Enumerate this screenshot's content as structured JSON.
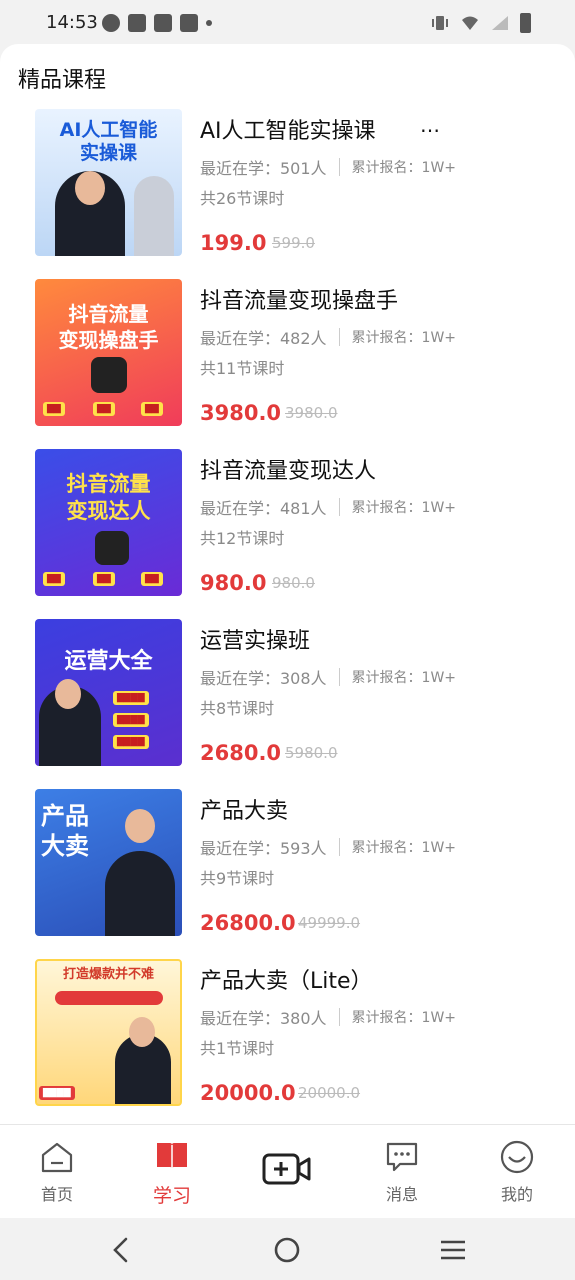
{
  "status": {
    "time": "14:53"
  },
  "section_title": "精品课程",
  "courses": [
    {
      "title": "AI人工智能实操课",
      "ellipsis": "…",
      "recent": "最近在学：501人",
      "enrolled": "累计报名：1W+",
      "lessons": "共26节课时",
      "price": "199.0",
      "original_price": "599.0",
      "cover_text": "AI人工智能\n实操课"
    },
    {
      "title": "抖音流量变现操盘手",
      "recent": "最近在学：482人",
      "enrolled": "累计报名：1W+",
      "lessons": "共11节课时",
      "price": "3980.0",
      "original_price": "3980.0",
      "cover_text": "抖音流量\n变现操盘手"
    },
    {
      "title": "抖音流量变现达人",
      "recent": "最近在学：481人",
      "enrolled": "累计报名：1W+",
      "lessons": "共12节课时",
      "price": "980.0",
      "original_price": "980.0",
      "cover_text": "抖音流量\n变现达人"
    },
    {
      "title": "运营实操班",
      "recent": "最近在学：308人",
      "enrolled": "累计报名：1W+",
      "lessons": "共8节课时",
      "price": "2680.0",
      "original_price": "5980.0",
      "cover_text": "运营大全"
    },
    {
      "title": "产品大卖",
      "recent": "最近在学：593人",
      "enrolled": "累计报名：1W+",
      "lessons": "共9节课时",
      "price": "26800.0",
      "original_price": "49999.0",
      "cover_text": "产品\n大卖"
    },
    {
      "title": "产品大卖（Lite）",
      "recent": "最近在学：380人",
      "enrolled": "累计报名：1W+",
      "lessons": "共1节课时",
      "price": "20000.0",
      "original_price": "20000.0",
      "cover_text": "打造爆款并不难"
    }
  ],
  "tabbar": {
    "home": "首页",
    "learn": "学习",
    "messages": "消息",
    "mine": "我的"
  },
  "colors": {
    "accent": "#e23a3a",
    "muted": "#8a8a8a"
  }
}
